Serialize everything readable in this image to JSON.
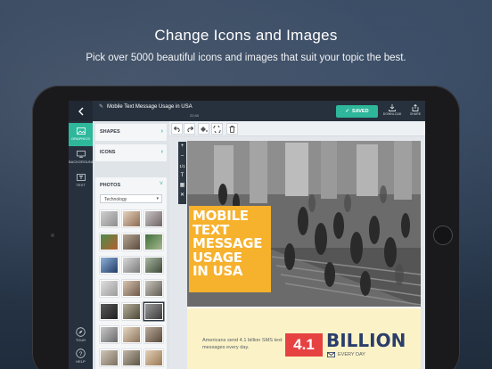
{
  "promo": {
    "headline": "Change Icons and Images",
    "subline": "Pick over 5000 beautiful icons and images that suit your topic the best."
  },
  "app": {
    "doc_title": "Mobile Text Message Usage in USA",
    "doc_time": "22:40",
    "saved_label": "SAVED",
    "download_label": "DOWNLOAD",
    "share_label": "SHARE",
    "accent_color": "#2eb79b"
  },
  "rail": {
    "items": [
      {
        "label": "GRAPHICS",
        "icon": "image-icon",
        "active": true
      },
      {
        "label": "BACKGROUND",
        "icon": "monitor-icon",
        "active": false
      },
      {
        "label": "TEXT",
        "icon": "text-icon",
        "active": false
      }
    ],
    "tour_label": "TOUR",
    "help_label": "HELP"
  },
  "panel": {
    "shapes_label": "SHAPES",
    "icons_label": "ICONS",
    "photos_label": "PHOTOS",
    "category_value": "Technology"
  },
  "canvas": {
    "side_tools": [
      "+",
      "–",
      "1/1",
      "T",
      "▦",
      "✕"
    ],
    "title_lines": [
      "MOBILE",
      "TEXT",
      "MESSAGE",
      "USAGE",
      "IN USA"
    ],
    "stats_text": "Americans send 4.1 billion SMS text messages every day.",
    "big_number": "4.1",
    "big_word": "BILLION",
    "every_day": "EVERY DAY",
    "title_color": "#f6b12d",
    "number_color": "#e64242",
    "word_color": "#2b3d6b"
  }
}
